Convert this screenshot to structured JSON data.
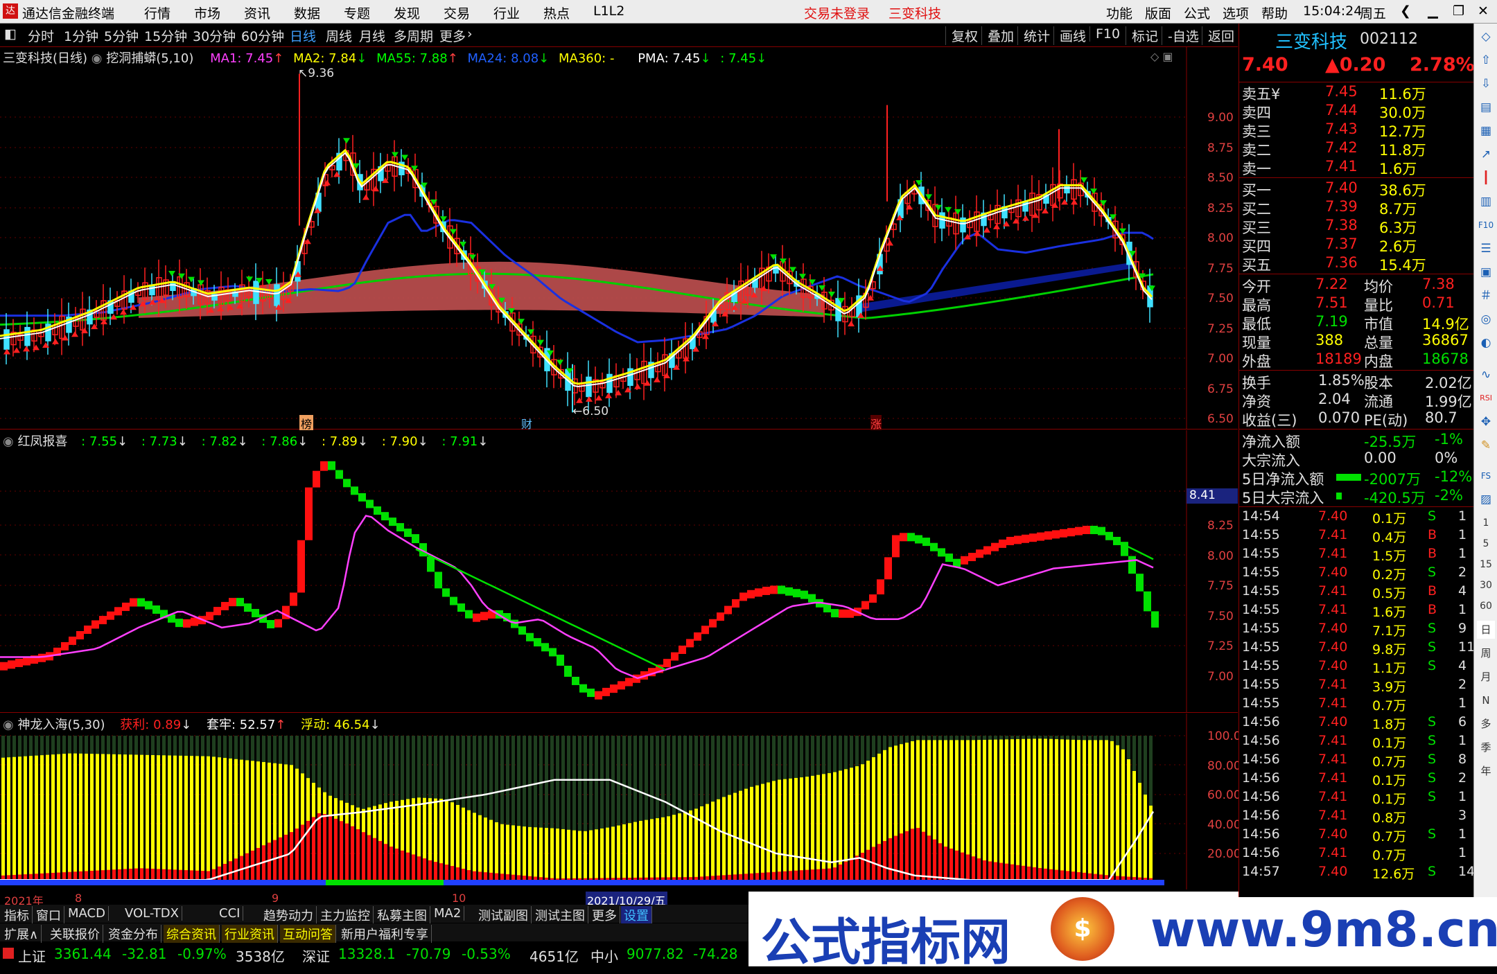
{
  "menubar": {
    "app_title": "通达信金融终端",
    "items": [
      "行情",
      "市场",
      "资讯",
      "数据",
      "专题",
      "发现",
      "交易",
      "行业",
      "热点",
      "L1L2"
    ],
    "trade_status": "交易未登录",
    "stock_name": "三变科技",
    "right_items": [
      "功能",
      "版面",
      "公式",
      "选项",
      "帮助"
    ],
    "time": "15:04:24",
    "weekday": "周五"
  },
  "timeframe": {
    "items": [
      "分时",
      "1分钟",
      "5分钟",
      "15分钟",
      "30分钟",
      "60分钟",
      "日线",
      "周线",
      "月线",
      "多周期",
      "更多"
    ],
    "active": "日线",
    "tools": [
      "复权",
      "叠加",
      "统计",
      "画线",
      "F10",
      "标记",
      "-自选",
      "返回"
    ]
  },
  "main_chart": {
    "title": "三变科技(日线)",
    "indicator": "挖洞捕蟒(5,10)",
    "ma": [
      {
        "label": "MA1: 7.45",
        "color": "#ff40ff"
      },
      {
        "label": "MA2: 7.84",
        "color": "#ffff00"
      },
      {
        "label": "MA55: 7.88",
        "color": "#00ff00"
      },
      {
        "label": "MA24: 8.08",
        "color": "#2060ff"
      },
      {
        "label": "MA360: -",
        "color": "#ffff00"
      },
      {
        "label": "PMA: 7.45",
        "color": "#ffffff"
      },
      {
        "label": ": 7.45",
        "color": "#00ff00"
      }
    ],
    "high_label": "9.36",
    "low_label": "6.50",
    "y_ticks": [
      "9.00",
      "8.75",
      "8.50",
      "8.25",
      "8.00",
      "7.75",
      "7.50",
      "7.25",
      "7.00",
      "6.75",
      "6.50"
    ],
    "markers": [
      "榜",
      "财",
      "涨"
    ]
  },
  "panel2": {
    "title": "红凤报喜",
    "values": [
      ": 7.55",
      ": 7.73",
      ": 7.82",
      ": 7.86",
      ": 7.89",
      ": 7.90",
      ": 7.91"
    ],
    "current": "8.41",
    "y_ticks": [
      "8.25",
      "8.00",
      "7.75",
      "7.50",
      "7.25",
      "7.00"
    ]
  },
  "panel3": {
    "title": "神龙入海(5,30)",
    "items": [
      {
        "label": "获利: 0.89",
        "color": "#ff2020"
      },
      {
        "label": "套牢: 52.57",
        "color": "#ffffff"
      },
      {
        "label": "浮动: 46.54",
        "color": "#ffff00"
      }
    ],
    "y_ticks": [
      "100.0",
      "80.00",
      "60.00",
      "40.00",
      "20.00"
    ]
  },
  "dateaxis": {
    "labels": [
      "2021年",
      "8",
      "9",
      "10"
    ],
    "cursor": "2021/10/29/五"
  },
  "tabs": {
    "row1": [
      "指标",
      "窗口",
      "MACD",
      "VOL-TDX",
      "CCI",
      "趋势动力",
      "主力监控",
      "私募主图",
      "MA2",
      "测试副图",
      "测试主图",
      "更多",
      "设置"
    ],
    "row2": [
      "扩展∧",
      "关联报价",
      "资金分布",
      "综合资讯",
      "行业资讯",
      "互动问答",
      "新用户福利专享"
    ]
  },
  "index_bar": [
    {
      "name": "上证",
      "value": "3361.44",
      "change": "-32.81",
      "pct": "-0.97%",
      "vol": "3538亿"
    },
    {
      "name": "深证",
      "value": "13328.1",
      "change": "-70.79",
      "pct": "-0.53%",
      "vol": "4651亿"
    },
    {
      "name": "中小",
      "value": "9077.82",
      "change": "-74.28",
      "pct": "",
      "vol": ""
    }
  ],
  "quote": {
    "name": "三变科技",
    "code": "002112",
    "price": "7.40",
    "change": "▲0.20",
    "pct": "2.78%",
    "asks": [
      [
        "卖五¥",
        "7.45",
        "11.6万"
      ],
      [
        "卖四",
        "7.44",
        "30.0万"
      ],
      [
        "卖三",
        "7.43",
        "12.7万"
      ],
      [
        "卖二",
        "7.42",
        "11.8万"
      ],
      [
        "卖一",
        "7.41",
        "1.6万"
      ]
    ],
    "bids": [
      [
        "买一",
        "7.40",
        "38.6万"
      ],
      [
        "买二",
        "7.39",
        "8.7万"
      ],
      [
        "买三",
        "7.38",
        "6.3万"
      ],
      [
        "买四",
        "7.37",
        "2.6万"
      ],
      [
        "买五",
        "7.36",
        "15.4万"
      ]
    ],
    "stats": [
      [
        "今开",
        "7.22",
        "均价",
        "7.38"
      ],
      [
        "最高",
        "7.51",
        "量比",
        "0.71"
      ],
      [
        "最低",
        "7.19",
        "市值",
        "14.9亿"
      ],
      [
        "现量",
        "388",
        "总量",
        "36867"
      ],
      [
        "外盘",
        "18189",
        "内盘",
        "18678"
      ]
    ],
    "fund": [
      [
        "换手",
        "1.85%",
        "股本",
        "2.02亿"
      ],
      [
        "净资",
        "2.04",
        "流通",
        "1.99亿"
      ],
      [
        "收益(三)",
        "0.070",
        "PE(动)",
        "80.7"
      ]
    ],
    "flow": [
      [
        "净流入额",
        "-25.5万",
        "-1%"
      ],
      [
        "大宗流入",
        "0.00",
        "0%"
      ],
      [
        "5日净流入额",
        "-2007万",
        "-12%"
      ],
      [
        "5日大宗流入",
        "-420.5万",
        "-2%"
      ]
    ],
    "ticks": [
      [
        "14:54",
        "7.40",
        "0.1万",
        "S",
        "1"
      ],
      [
        "14:55",
        "7.41",
        "0.4万",
        "B",
        "1"
      ],
      [
        "14:55",
        "7.41",
        "1.5万",
        "B",
        "1"
      ],
      [
        "14:55",
        "7.40",
        "0.2万",
        "S",
        "2"
      ],
      [
        "14:55",
        "7.41",
        "0.5万",
        "B",
        "4"
      ],
      [
        "14:55",
        "7.41",
        "1.6万",
        "B",
        "1"
      ],
      [
        "14:55",
        "7.40",
        "7.1万",
        "S",
        "9"
      ],
      [
        "14:55",
        "7.40",
        "9.8万",
        "S",
        "11"
      ],
      [
        "14:55",
        "7.40",
        "1.1万",
        "S",
        "4"
      ],
      [
        "14:55",
        "7.41",
        "3.9万",
        "",
        "2"
      ],
      [
        "14:55",
        "7.41",
        "0.7万",
        "",
        "1"
      ],
      [
        "14:56",
        "7.40",
        "1.8万",
        "S",
        "6"
      ],
      [
        "14:56",
        "7.41",
        "0.1万",
        "S",
        "1"
      ],
      [
        "14:56",
        "7.41",
        "0.7万",
        "S",
        "8"
      ],
      [
        "14:56",
        "7.41",
        "0.1万",
        "S",
        "2"
      ],
      [
        "14:56",
        "7.41",
        "0.1万",
        "S",
        "1"
      ],
      [
        "14:56",
        "7.41",
        "0.8万",
        "",
        "3"
      ],
      [
        "14:56",
        "7.40",
        "0.7万",
        "S",
        "1"
      ],
      [
        "14:56",
        "7.41",
        "0.7万",
        "",
        "1"
      ],
      [
        "14:57",
        "7.40",
        "12.6万",
        "S",
        "14"
      ]
    ]
  },
  "iconbar": [
    "日",
    "周",
    "月",
    "N",
    "多",
    "季",
    "年"
  ],
  "ad": {
    "text": "公式指标网",
    "url": "www.9m8.cn"
  },
  "colors": {
    "up": "#ff2020",
    "down": "#00e000",
    "axis": "#800000",
    "yellow": "#ffff00"
  }
}
